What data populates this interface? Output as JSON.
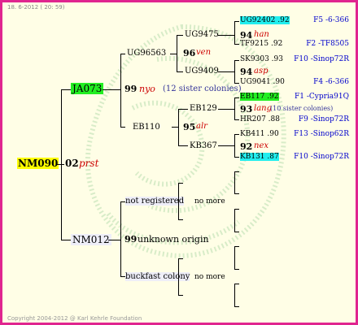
{
  "header": {
    "date": "18. 6-2012 ( 20: 59)"
  },
  "root": {
    "id": "NM090",
    "num": "02",
    "tag": "prst"
  },
  "sire": {
    "id": "JA073"
  },
  "dam": {
    "id": "NM012"
  },
  "ss": {
    "id": "UG96563",
    "num": "99",
    "tag": "nyo",
    "note": "(12 sister colonies)"
  },
  "sd": {
    "id": "EB110",
    "num": "95",
    "tag": "alr"
  },
  "sss": {
    "id": "UG9475",
    "num": "96",
    "tag": "ven"
  },
  "ssd": {
    "id": "UG9409",
    "num": "94",
    "tag": "asp"
  },
  "sds": {
    "id": "EB129",
    "num": "93",
    "tag": "lang",
    "note": "(10 sister colonies)"
  },
  "sdd": {
    "id": "KB367",
    "num": "92",
    "tag": "nex"
  },
  "leaves": [
    {
      "left": "UG92402 .92",
      "right": "F5 -6-366"
    },
    {
      "left": "TF9215 .92",
      "right": "F2 -TF8505"
    },
    {
      "left": "SK9303 .93",
      "right": "F10 -Sinop72R"
    },
    {
      "left": "UG9041 .90",
      "right": "F4 -6-366"
    },
    {
      "left": "EB117 .92",
      "right": "F1 -Cypria91Q"
    },
    {
      "left": "HR207 .88",
      "right": "F9 -Sinop72R"
    },
    {
      "left": "KB411 .90",
      "right": "F13 -Sinop62R"
    },
    {
      "left": "KB131 .87",
      "right": "F10 -Sinop72R"
    }
  ],
  "ds": {
    "label": "not registered",
    "nomore": "no more"
  },
  "dd": {
    "label": "buckfast colony",
    "nomore": "no more"
  },
  "dnum": {
    "num": "99",
    "text": "unknown origin"
  },
  "footer": {
    "copyright": "Copyright 2004-2012 @ Karl Kehrle Foundation"
  },
  "colors": {
    "border": "#e0258f",
    "background": "#fffee6",
    "green": "#22ee22",
    "cyan": "#22eeee",
    "yellow": "#ffff00"
  }
}
